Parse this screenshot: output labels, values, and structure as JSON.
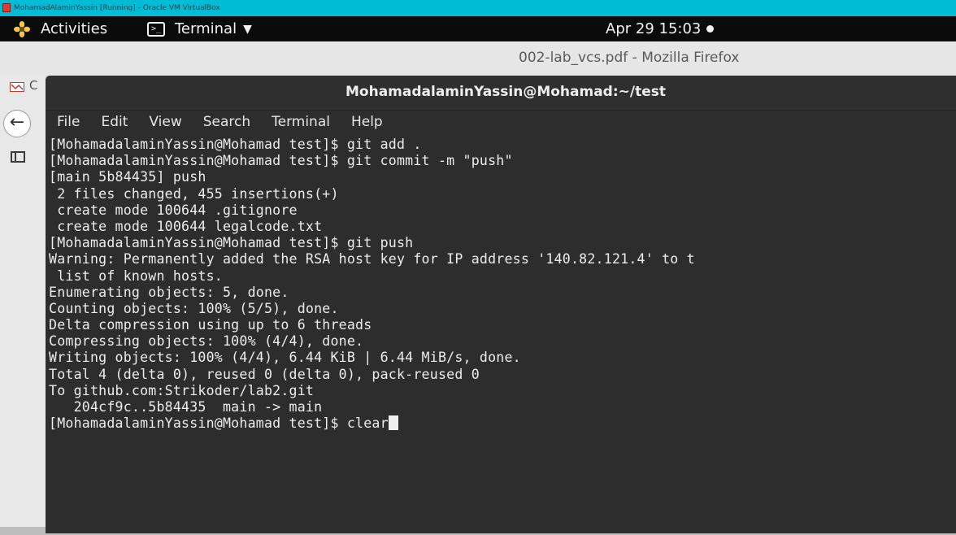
{
  "vbox": {
    "title": "MohamadAlaminYassin [Running] - Oracle VM VirtualBox"
  },
  "gnome": {
    "activities": "Activities",
    "app_menu": "Terminal",
    "clock": "Apr 29  15:03"
  },
  "firefox": {
    "window_title": "002-lab_vcs.pdf - Mozilla Firefox",
    "tab_letter": "C"
  },
  "terminal": {
    "title": "MohamadalaminYassin@Mohamad:~/test",
    "menu": [
      "File",
      "Edit",
      "View",
      "Search",
      "Terminal",
      "Help"
    ],
    "lines": [
      "[MohamadalaminYassin@Mohamad test]$ git add .",
      "[MohamadalaminYassin@Mohamad test]$ git commit -m \"push\"",
      "[main 5b84435] push",
      " 2 files changed, 455 insertions(+)",
      " create mode 100644 .gitignore",
      " create mode 100644 legalcode.txt",
      "[MohamadalaminYassin@Mohamad test]$ git push",
      "Warning: Permanently added the RSA host key for IP address '140.82.121.4' to t",
      " list of known hosts.",
      "Enumerating objects: 5, done.",
      "Counting objects: 100% (5/5), done.",
      "Delta compression using up to 6 threads",
      "Compressing objects: 100% (4/4), done.",
      "Writing objects: 100% (4/4), 6.44 KiB | 6.44 MiB/s, done.",
      "Total 4 (delta 0), reused 0 (delta 0), pack-reused 0",
      "To github.com:Strikoder/lab2.git",
      "   204cf9c..5b84435  main -> main"
    ],
    "prompt_line": "[MohamadalaminYassin@Mohamad test]$ clear"
  }
}
